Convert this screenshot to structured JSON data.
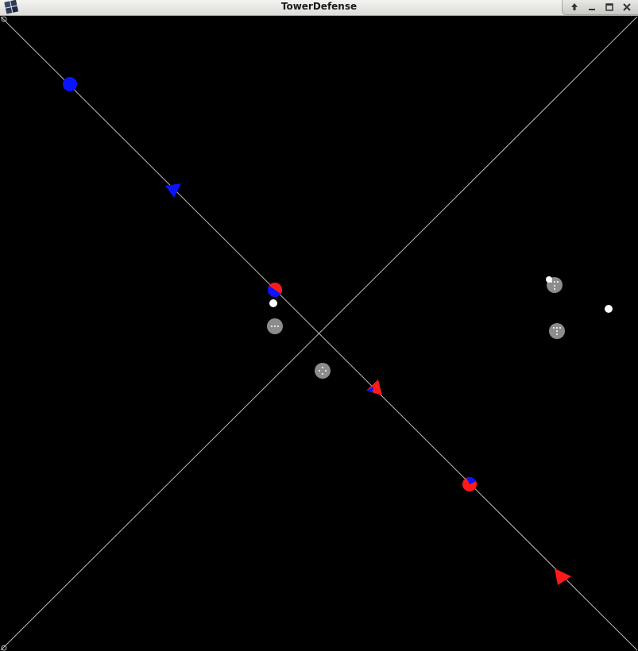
{
  "window": {
    "title": "TowerDefense"
  },
  "icons": {
    "app": "app-grid-icon",
    "controls": [
      "always-on-top-icon",
      "minimize-icon",
      "maximize-icon",
      "close-icon"
    ]
  },
  "colors": {
    "background": "#000000",
    "path": "#bdbdbd",
    "player_blue": "#0a14ff",
    "player_red": "#ff1a1a",
    "tower": "#8c8c8c",
    "projectile": "#ffffff"
  },
  "game": {
    "paths": [
      "diagonal-top-left-to-bottom-right",
      "diagonal-bottom-left-to-top-right"
    ],
    "units": [
      {
        "kind": "circle",
        "team": "blue",
        "health": 1.0
      },
      {
        "kind": "triangle",
        "team": "blue",
        "direction": "down-right"
      },
      {
        "kind": "circle",
        "team": "mixed",
        "health": 0.5
      },
      {
        "kind": "triangle",
        "team": "red",
        "direction": "down-right"
      },
      {
        "kind": "circle",
        "team": "mixed",
        "health": 0.25
      },
      {
        "kind": "triangle",
        "team": "red",
        "direction": "down-right"
      }
    ],
    "towers": 4,
    "projectiles": 4
  }
}
